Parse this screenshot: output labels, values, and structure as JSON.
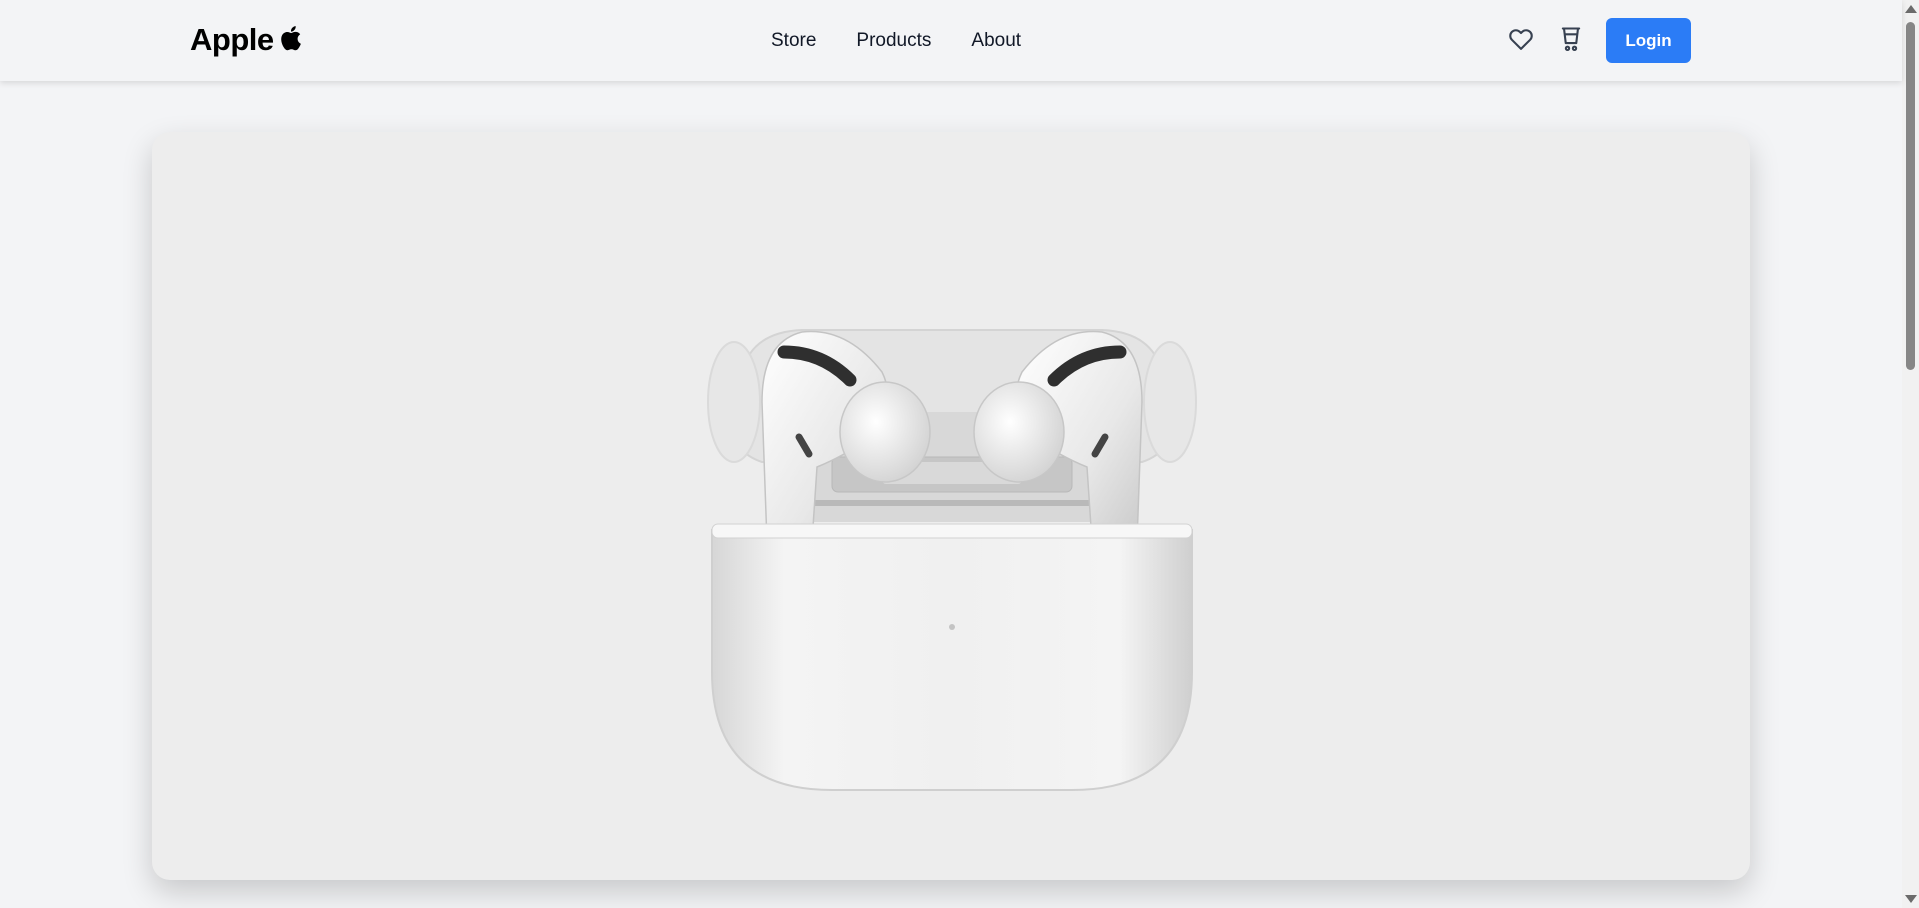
{
  "header": {
    "logo_text": "Apple",
    "logo_icon": "apple-logo-icon",
    "nav": [
      "Store",
      "Products",
      "About"
    ],
    "favorites_icon": "heart-icon",
    "cart_icon": "cart-icon",
    "login_label": "Login"
  },
  "hero": {
    "product_image": "airpods-pro-case-image"
  },
  "colors": {
    "accent": "#2b7cf6",
    "page_bg": "#f3f4f6",
    "card_bg": "#ededed"
  }
}
